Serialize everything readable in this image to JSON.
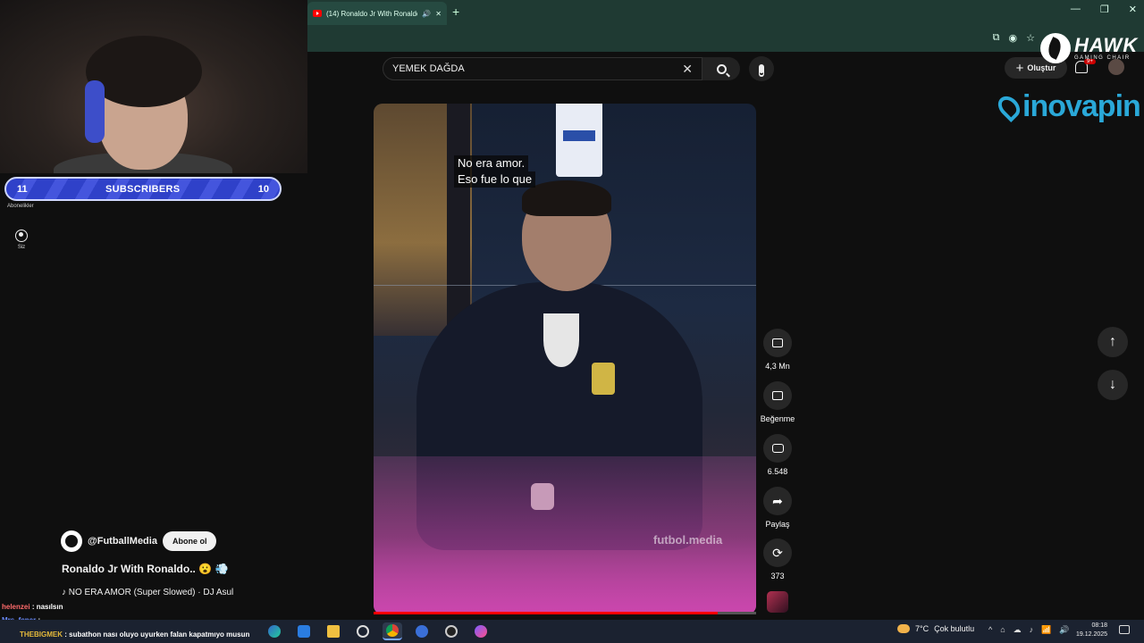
{
  "browser": {
    "tab_title": "(14) Ronaldo Jr With Ronaldo",
    "new_tab_symbol": "+",
    "window_controls": [
      "—",
      "❐",
      "✕"
    ],
    "address_icons": [
      "⧉",
      "◉",
      "☆"
    ]
  },
  "stream_overlay": {
    "subscribers_left": "11",
    "subscribers_label": "SUBSCRIBERS",
    "subscribers_right": "10",
    "subscribers_caption": "Abonelikler",
    "sidebar_you_label": "Siz",
    "brand_hawk": "HAWK",
    "brand_hawk_sub": "GAMING CHAIR",
    "brand_inova": "inovapin"
  },
  "header": {
    "search_value": "YEMEK  DAĞDA",
    "clear_symbol": "✕",
    "create_label": "Oluştur",
    "create_plus": "+",
    "notification_count": "9+"
  },
  "video": {
    "caption_line1": "No era amor.",
    "caption_line2": "Eso fue lo que",
    "watermark": "futbol.media",
    "progress_fraction": 0.9,
    "channel_name": "@FutballMedia",
    "subscribe_label": "Abone ol",
    "title": "Ronaldo Jr With Ronaldo.. 😮 💨",
    "music": "♪ NO ERA AMOR (Super Slowed) · DJ Asul"
  },
  "actions": {
    "likes": "4,3 Mn",
    "dislike_label": "Beğenme",
    "comments": "6.548",
    "share_label": "Paylaş",
    "remix_count": "373"
  },
  "nav": {
    "up_symbol": "↑",
    "down_symbol": "↓"
  },
  "chat": [
    {
      "user": "helenzei",
      "msg": ": nasılsın",
      "color": "#ff6b6b"
    },
    {
      "user": "Mrs_fener",
      "msg": ":",
      "color": "#6b8cff"
    },
    {
      "user": "THEBIGMEK",
      "msg": ": subathon nası oluyo uyurken falan kapatmıyo musun",
      "color": "#e4b93a"
    }
  ],
  "taskbar": {
    "weather_temp": "7°C",
    "weather_desc": "Çok bulutlu",
    "time": "08:18",
    "date": "19.12.2025",
    "tray_icons": [
      "^",
      "⌂",
      "☁",
      "♪",
      "📶",
      "🔊"
    ]
  },
  "colors": {
    "yt_red": "#ff0000",
    "subs_blue": "#3b4bd8",
    "inova_blue": "#2aa8d8"
  }
}
